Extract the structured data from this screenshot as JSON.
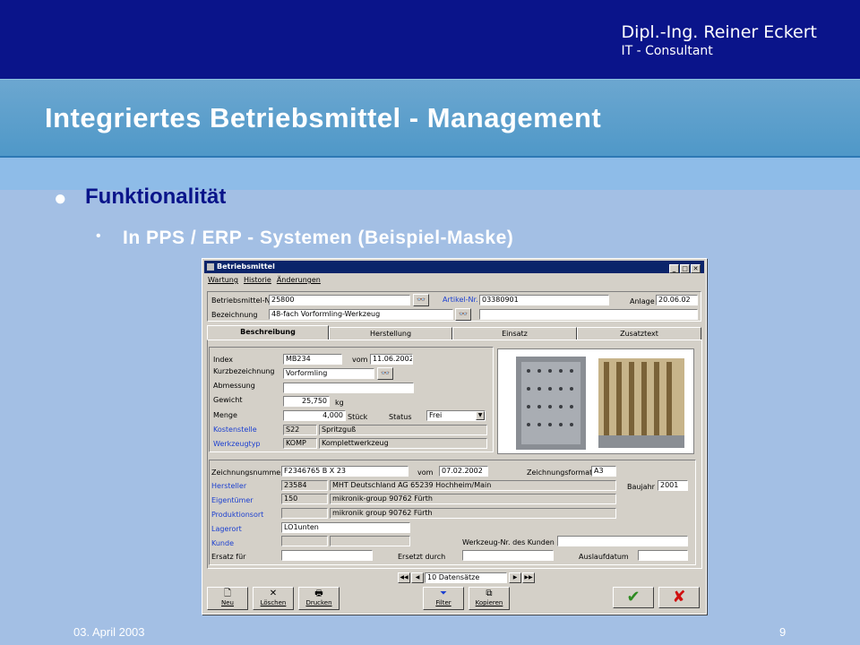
{
  "header": {
    "author_name": "Dipl.-Ing. Reiner Eckert",
    "author_role": "IT - Consultant"
  },
  "title": "Integriertes Betriebsmittel - Management",
  "bullets": {
    "level1": "Funktionalität",
    "level2": "In PPS / ERP - Systemen (Beispiel-Maske)"
  },
  "footer": {
    "date": "03. April 2003",
    "page": "9"
  },
  "window": {
    "title": "Betriebsmittel",
    "menu": [
      "Wartung",
      "Historie",
      "Änderungen"
    ],
    "top": {
      "betriebsmittel_nr_label": "Betriebsmittel-Nr.",
      "betriebsmittel_nr": "25800",
      "artikel_nr_label": "Artikel-Nr.",
      "artikel_nr": "03380901",
      "anlage_label": "Anlage",
      "anlage": "20.06.02",
      "bezeichnung_label": "Bezeichnung",
      "bezeichnung": "48-fach Vorformling-Werkzeug",
      "bezeichnung2": ""
    },
    "tabs": [
      "Beschreibung",
      "Herstellung",
      "Einsatz",
      "Zusatztext"
    ],
    "desc": {
      "index_label": "Index",
      "index": "MB234",
      "vom_label": "vom",
      "vom": "11.06.2002",
      "kurz_label": "Kurzbezeichnung",
      "kurz": "Vorformling",
      "abmessung_label": "Abmessung",
      "abmessung": "",
      "gewicht_label": "Gewicht",
      "gewicht": "25,750",
      "gewicht_unit": "kg",
      "menge_label": "Menge",
      "menge": "4,000",
      "menge_unit": "Stück",
      "status_label": "Status",
      "status": "Frei",
      "kostenstelle_label": "Kostenstelle",
      "kostenstelle": "S22",
      "kostenstelle_text": "Spritzguß",
      "werkzeugtyp_label": "Werkzeugtyp",
      "werkzeugtyp": "KOMP",
      "werkzeugtyp_text": "Komplettwerkzeug"
    },
    "lower": {
      "zeichnungsnr_label": "Zeichnungsnummer",
      "zeichnungsnr": "F2346765 B X 23",
      "vom_label": "vom",
      "vom": "07.02.2002",
      "format_label": "Zeichnungsformat",
      "format": "A3",
      "hersteller_label": "Hersteller",
      "hersteller_nr": "23584",
      "hersteller": "MHT Deutschland AG 65239 Hochheim/Main",
      "baujahr_label": "Baujahr",
      "baujahr": "2001",
      "eigentuemer_label": "Eigentümer",
      "eigentuemer_nr": "150",
      "eigentuemer": "mikronik-group 90762 Fürth",
      "produktionsort_label": "Produktionsort",
      "produktionsort_nr": "",
      "produktionsort": "mikronik group 90762 Fürth",
      "lagerort_label": "Lagerort",
      "lagerort": "LO1unten",
      "kunde_label": "Kunde",
      "kunde_nr": "",
      "kunde": "",
      "wz_kunde_label": "Werkzeug-Nr. des Kunden",
      "wz_kunde": "",
      "ersatz_fuer_label": "Ersatz für",
      "ersatz_fuer": "",
      "ersetzt_durch_label": "Ersetzt durch",
      "ersetzt_durch": "",
      "auslauf_label": "Auslaufdatum",
      "auslauf": ""
    },
    "nav": {
      "record_count": "10 Datensätze"
    },
    "toolbar": {
      "neu": "Neu",
      "loeschen": "Löschen",
      "drucken": "Drucken",
      "filter": "Filter",
      "kopieren": "Kopieren"
    }
  }
}
